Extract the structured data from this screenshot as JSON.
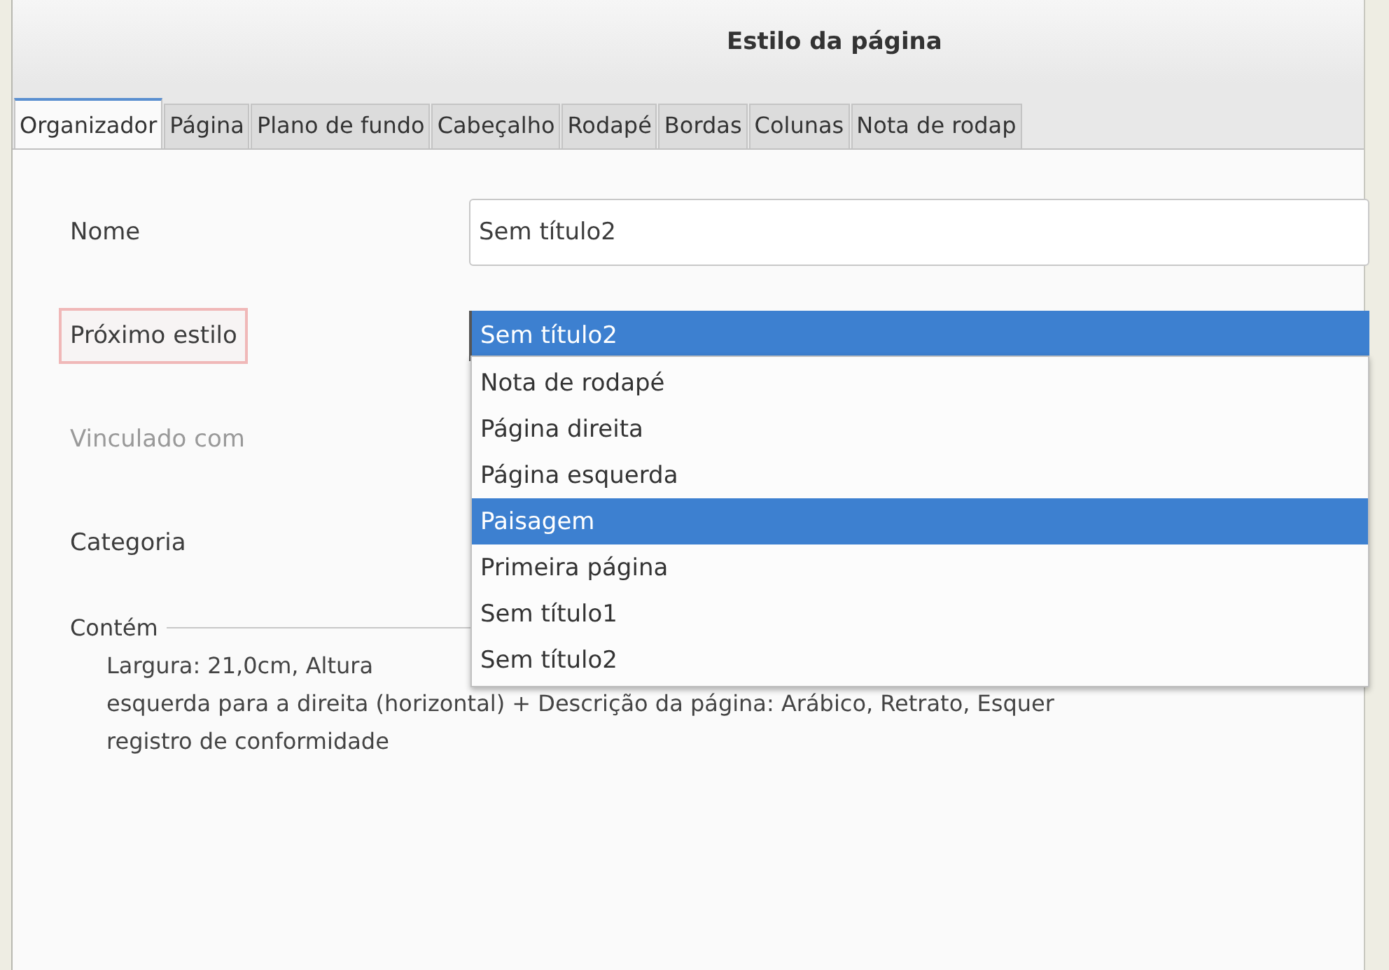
{
  "window": {
    "title": "Estilo da página"
  },
  "tabs": [
    {
      "label": "Organizador",
      "selected": true
    },
    {
      "label": "Página",
      "selected": false
    },
    {
      "label": "Plano de fundo",
      "selected": false
    },
    {
      "label": "Cabeçalho",
      "selected": false
    },
    {
      "label": "Rodapé",
      "selected": false
    },
    {
      "label": "Bordas",
      "selected": false
    },
    {
      "label": "Colunas",
      "selected": false
    },
    {
      "label": "Nota de rodap",
      "selected": false
    }
  ],
  "fields": [
    {
      "label": "Nome",
      "kind": "text",
      "value": "Sem título2",
      "disabled": false,
      "highlighted": false
    },
    {
      "label": "Próximo estilo",
      "kind": "combo",
      "value": "Sem título2",
      "disabled": false,
      "highlighted": true
    },
    {
      "label": "Vinculado com",
      "kind": "none",
      "disabled": true,
      "highlighted": false
    },
    {
      "label": "Categoria",
      "kind": "none",
      "disabled": false,
      "highlighted": false
    }
  ],
  "dropdown": {
    "items": [
      {
        "label": "Nota de rodapé",
        "selected": false
      },
      {
        "label": "Página direita",
        "selected": false
      },
      {
        "label": "Página esquerda",
        "selected": false
      },
      {
        "label": "Paisagem",
        "selected": true
      },
      {
        "label": "Primeira página",
        "selected": false
      },
      {
        "label": "Sem título1",
        "selected": false
      },
      {
        "label": "Sem título2",
        "selected": false
      }
    ]
  },
  "contains": {
    "title": "Contém",
    "lines": [
      "Largura: 21,0cm, Altura",
      "esquerda para a direita (horizontal) + Descrição da página: Arábico, Retrato, Esquer",
      "registro de conformidade"
    ]
  }
}
